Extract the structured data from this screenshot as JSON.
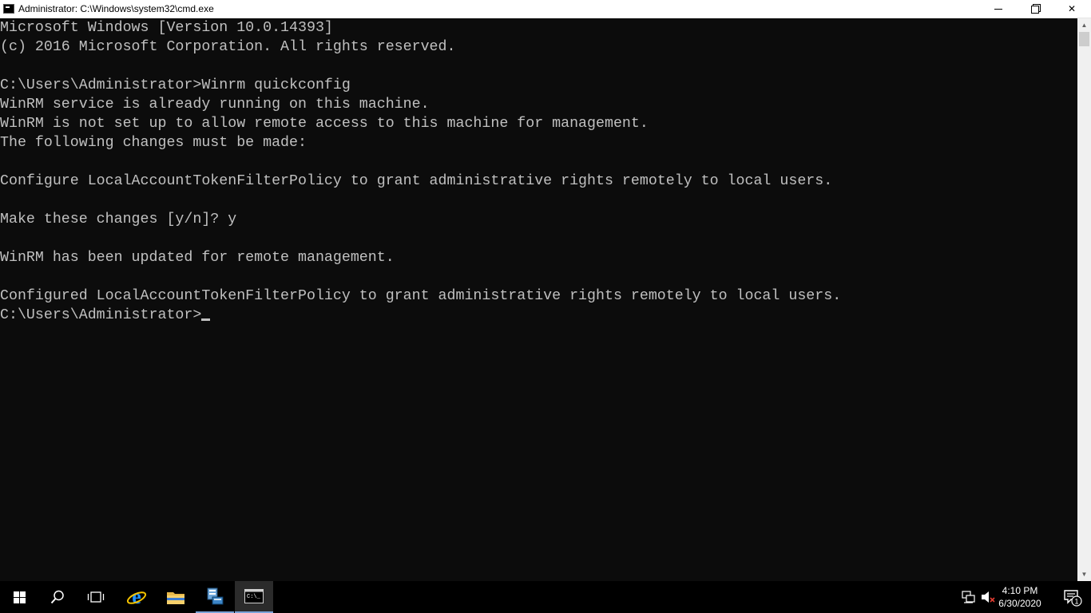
{
  "window": {
    "title": "Administrator: C:\\Windows\\system32\\cmd.exe",
    "controls": {
      "minimize": "minimize-icon",
      "maximize": "restore-icon",
      "close": "✕"
    }
  },
  "console": {
    "lines": [
      "Microsoft Windows [Version 10.0.14393]",
      "(c) 2016 Microsoft Corporation. All rights reserved.",
      "",
      "C:\\Users\\Administrator>Winrm quickconfig",
      "WinRM service is already running on this machine.",
      "WinRM is not set up to allow remote access to this machine for management.",
      "The following changes must be made:",
      "",
      "Configure LocalAccountTokenFilterPolicy to grant administrative rights remotely to local users.",
      "",
      "Make these changes [y/n]? y",
      "",
      "WinRM has been updated for remote management.",
      "",
      "Configured LocalAccountTokenFilterPolicy to grant administrative rights remotely to local users."
    ],
    "prompt": "C:\\Users\\Administrator>",
    "text_color": "#c0c0c0",
    "background": "#0c0c0c"
  },
  "taskbar": {
    "items": [
      {
        "name": "start-button",
        "icon": "windows-logo-icon"
      },
      {
        "name": "search-button",
        "icon": "search-icon"
      },
      {
        "name": "task-view-button",
        "icon": "task-view-icon"
      },
      {
        "name": "internet-explorer-button",
        "icon": "internet-explorer-icon"
      },
      {
        "name": "file-explorer-button",
        "icon": "folder-icon"
      },
      {
        "name": "server-manager-button",
        "icon": "server-manager-icon"
      },
      {
        "name": "cmd-button",
        "icon": "command-prompt-icon"
      }
    ],
    "accent": "#7aa3d8",
    "clock": {
      "time": "4:10 PM",
      "date": "6/30/2020"
    },
    "notifications_count": "1"
  }
}
